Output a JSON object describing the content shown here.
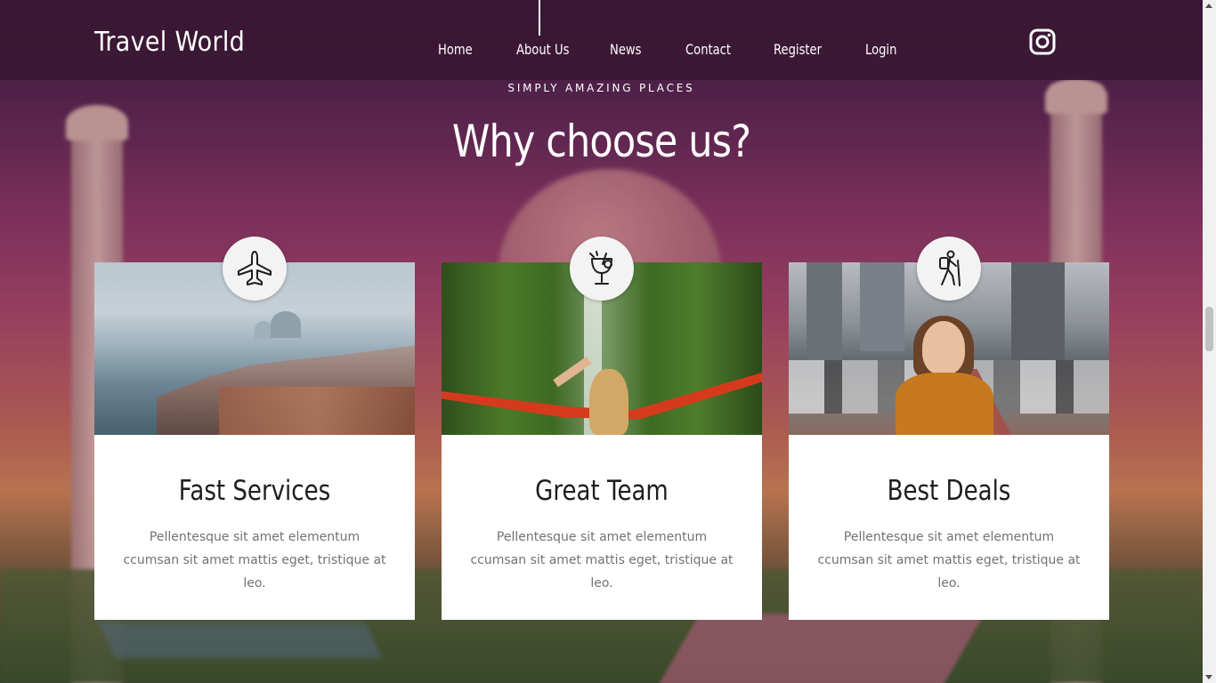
{
  "header": {
    "brand": "Travel World",
    "nav": [
      {
        "label": "Home"
      },
      {
        "label": "About Us"
      },
      {
        "label": "News"
      },
      {
        "label": "Contact"
      },
      {
        "label": "Register"
      },
      {
        "label": "Login"
      }
    ],
    "social_icon": "instagram-icon"
  },
  "hero": {
    "kicker": "SIMPLY AMAZING PLACES",
    "title": "Why choose us?"
  },
  "cards": [
    {
      "icon": "airplane-icon",
      "title": "Fast Services",
      "text": "Pellentesque sit amet elementum ccumsan sit amet mattis eget, tristique at leo."
    },
    {
      "icon": "cocktail-icon",
      "title": "Great Team",
      "text": "Pellentesque sit amet elementum ccumsan sit amet mattis eget, tristique at leo."
    },
    {
      "icon": "hiker-icon",
      "title": "Best Deals",
      "text": "Pellentesque sit amet elementum ccumsan sit amet mattis eget, tristique at leo."
    }
  ],
  "colors": {
    "header_bg": "#3a1834",
    "card_bg": "#ffffff",
    "title_text": "#1e1e1e",
    "body_text": "#727272"
  }
}
